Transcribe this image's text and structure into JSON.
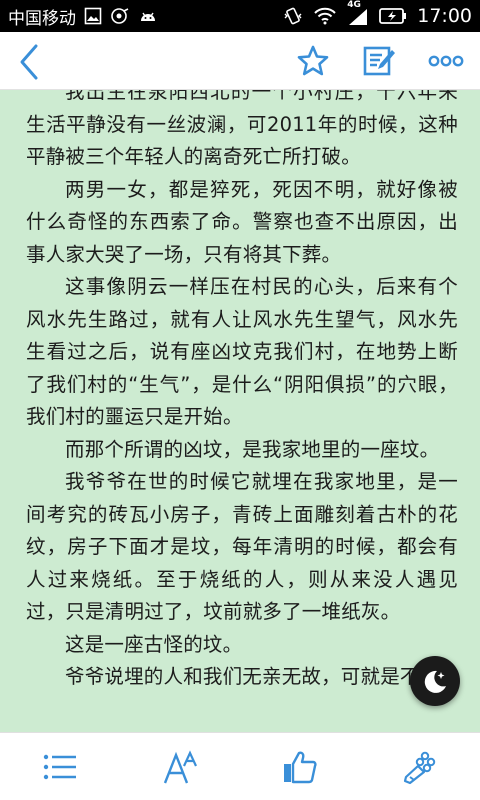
{
  "status_bar": {
    "carrier": "中国移动",
    "network": "4G",
    "time": "17:00"
  },
  "toolbar": {
    "back_icon": "chevron-left-icon",
    "favorite_icon": "star-icon",
    "note_icon": "note-edit-icon",
    "more_icon": "more-icon",
    "accent_color": "#3a8fd8"
  },
  "content": {
    "background": "#cdebd1",
    "paragraphs": [
      "我出生在泉阳西北的一个小村庄，十六年来生活平静没有一丝波澜，可2011年的时候，这种平静被三个年轻人的离奇死亡所打破。",
      "两男一女，都是猝死，死因不明，就好像被什么奇怪的东西索了命。警察也查不出原因，出事人家大哭了一场，只有将其下葬。",
      "这事像阴云一样压在村民的心头，后来有个风水先生路过，就有人让风水先生望气，风水先生看过之后，说有座凶坟克我们村，在地势上断了我们村的“生气”，是什么“阴阳俱损”的穴眼，我们村的噩运只是开始。",
      "而那个所谓的凶坟，是我家地里的一座坟。",
      "我爷爷在世的时候它就埋在我家地里，是一间考究的砖瓦小房子，青砖上面雕刻着古朴的花纹，房子下面才是坟，每年清明的时候，都会有人过来烧纸。至于烧纸的人，则从来没人遇见过，只是清明过了，坟前就多了一堆纸灰。",
      "这是一座古怪的坟。",
      "爷爷说埋的人和我们无亲无故，可就是不"
    ]
  },
  "night_mode_icon": "moon-stars-icon",
  "bottom_bar": {
    "items": [
      {
        "icon": "list-icon"
      },
      {
        "icon": "font-size-icon"
      },
      {
        "icon": "thumbs-up-icon"
      },
      {
        "icon": "flower-bouquet-icon"
      }
    ]
  }
}
